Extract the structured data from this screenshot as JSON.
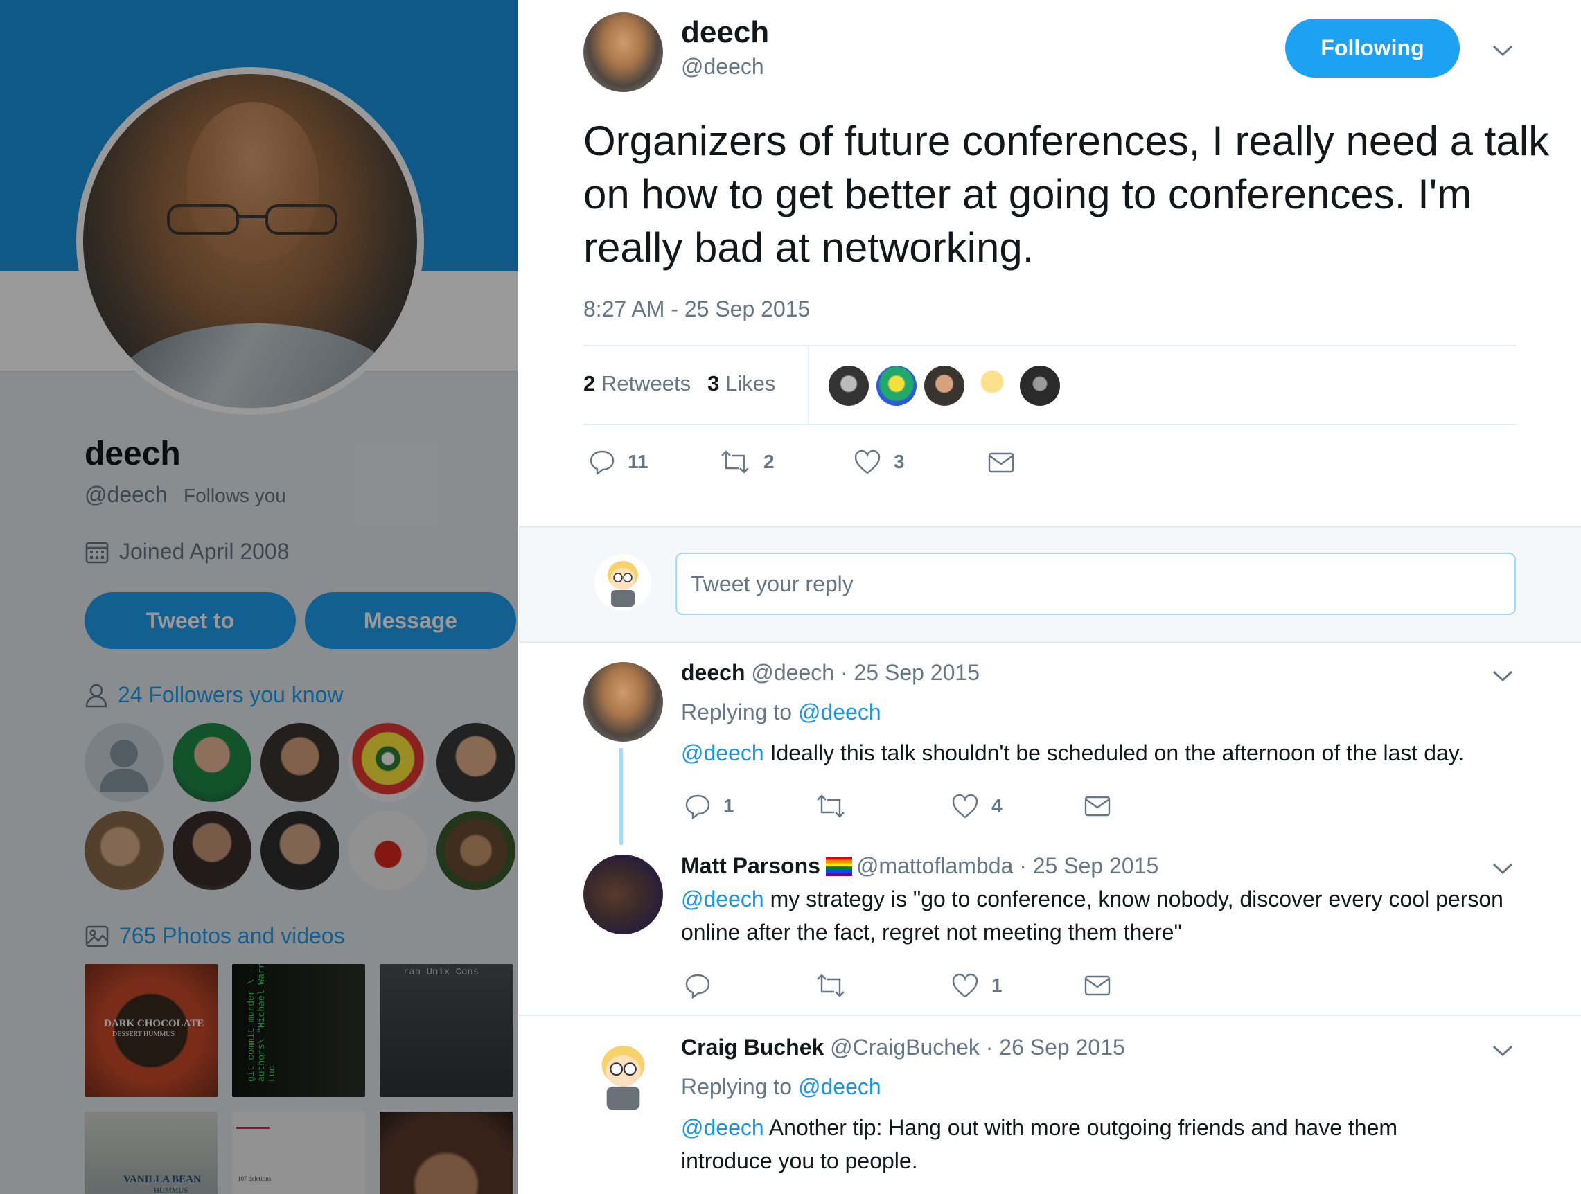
{
  "profile": {
    "name": "deech",
    "handle": "@deech",
    "follows_you": "Follows you",
    "joined": "Joined April 2008",
    "tweet_to_label": "Tweet to",
    "message_label": "Message",
    "followers_you_know": "24 Followers you know",
    "photos_and_videos": "765 Photos and videos",
    "thumbnails": [
      {
        "text": "DARK CHOCOLATE",
        "subtext": "DESSERT HUMMUS"
      },
      {
        "text": "git commit murder \\ --authors\\ \"Michael Warren Luc"
      },
      {
        "text": "ran Unix Cons"
      },
      {
        "text": "VANILLA BEAN",
        "subtext": "HUMMUS"
      },
      {
        "text": "107 deletions"
      },
      {
        "text": ""
      }
    ]
  },
  "tweet": {
    "author_name": "deech",
    "author_handle": "@deech",
    "following_label": "Following",
    "text": "Organizers of future conferences, I really need a talk on how to get better at going to conferences. I'm really bad at networking.",
    "timestamp": "8:27 AM - 25 Sep 2015",
    "retweets_count": "2",
    "retweets_label": "Retweets",
    "likes_count": "3",
    "likes_label": "Likes",
    "actions": {
      "replies": "11",
      "retweets": "2",
      "likes": "3"
    }
  },
  "reply_box": {
    "placeholder": "Tweet your reply"
  },
  "replies": [
    {
      "name": "deech",
      "handle": "@deech",
      "date": "· 25 Sep 2015",
      "replying_prefix": "Replying to",
      "replying_to": "@deech",
      "mention": "@deech",
      "text": " Ideally this talk shouldn't be scheduled on the afternoon of the last day.",
      "actions": {
        "replies": "1",
        "retweets": "",
        "likes": "4"
      }
    },
    {
      "name": "Matt Parsons",
      "handle": "@mattoflambda",
      "date": "· 25 Sep 2015",
      "mention": "@deech",
      "text": " my strategy is \"go to conference, know nobody, discover every cool person online after the fact, regret not meeting them there\"",
      "actions": {
        "replies": "",
        "retweets": "",
        "likes": "1"
      }
    },
    {
      "name": "Craig Buchek",
      "handle": "@CraigBuchek",
      "date": "· 26 Sep 2015",
      "replying_prefix": "Replying to",
      "replying_to": "@deech",
      "mention": "@deech",
      "text": " Another tip: Hang out with more outgoing friends and have them introduce you to people.",
      "actions": {
        "replies": "",
        "retweets": "",
        "likes": ""
      }
    }
  ],
  "colors": {
    "accent": "#1da1f2",
    "link": "#1b95e0",
    "muted": "#657786",
    "text": "#14171a"
  }
}
